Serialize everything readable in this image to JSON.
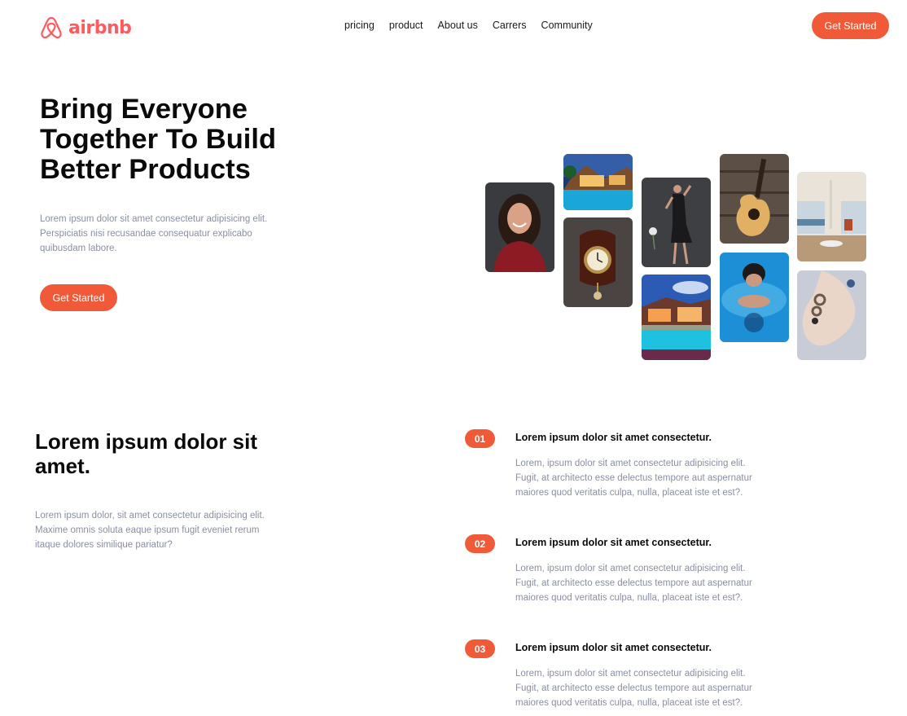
{
  "brand": {
    "name": "airbnb",
    "color": "#ff5a5f"
  },
  "nav": {
    "items": [
      "pricing",
      "product",
      "About us",
      "Carrers",
      "Community"
    ],
    "cta": "Get Started"
  },
  "hero": {
    "title": "Bring Everyone Together To Build Better Products",
    "description": "Lorem ipsum dolor sit amet consectetur adipisicing elit. Perspiciatis nisi recusandae consequatur explicabo quibusdam labore.",
    "cta": "Get Started"
  },
  "gallery": {
    "tiles": [
      "woman-portrait-photo",
      "villa-pool-photo",
      "wall-clock-photo",
      "dancer-photo",
      "resort-pool-photo",
      "guitar-photo",
      "swimmer-photo",
      "living-room-photo",
      "hand-rings-photo"
    ]
  },
  "features": {
    "title": "Lorem ipsum dolor sit amet.",
    "description": "Lorem ipsum dolor, sit amet consectetur adipisicing elit. Maxime omnis soluta eaque ipsum fugit eveniet rerum itaque dolores similique pariatur?",
    "steps": [
      {
        "number": "01",
        "title": "Lorem ipsum dolor sit amet consectetur.",
        "text": "Lorem, ipsum dolor sit amet consectetur adipisicing elit. Fugit, at architecto esse delectus tempore aut aspernatur maiores quod veritatis culpa, nulla, placeat iste et est?."
      },
      {
        "number": "02",
        "title": "Lorem ipsum dolor sit amet consectetur.",
        "text": "Lorem, ipsum dolor sit amet consectetur adipisicing elit. Fugit, at architecto esse delectus tempore aut aspernatur maiores quod veritatis culpa, nulla, placeat iste et est?."
      },
      {
        "number": "03",
        "title": "Lorem ipsum dolor sit amet consectetur.",
        "text": "Lorem, ipsum dolor sit amet consectetur adipisicing elit. Fugit, at architecto esse delectus tempore aut aspernatur maiores quod veritatis culpa, nulla, placeat iste et est?."
      }
    ]
  },
  "colors": {
    "accent": "#f05a38",
    "muted_text": "#8a8fa3"
  }
}
